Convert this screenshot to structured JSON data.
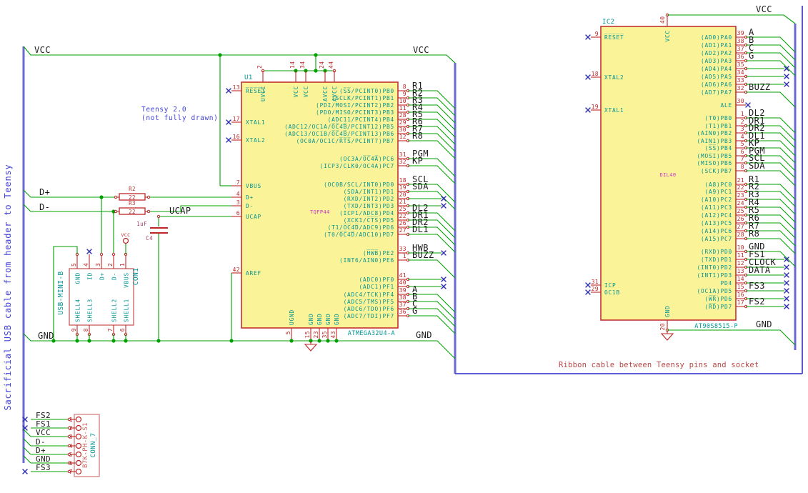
{
  "colors": {
    "wire": "#00a000",
    "bus": "#6a6ad4",
    "frame": "#4646cf",
    "pin": "#bf2626",
    "body_fill": "#fbf397",
    "name_cyan": "#009494",
    "label_black": "#1a1a1a",
    "note_blue": "#4141d9",
    "note_red": "#b94646",
    "magenta": "#c935c9",
    "comp_red": "#b03030",
    "cap_magenta": "#a83d6e",
    "conn_pink": "#d98989",
    "nc_blue": "#2f2fae"
  },
  "notes": {
    "teensy_line1": "Teensy 2.0",
    "teensy_line2": "(not fully drawn)",
    "usb_cable": "Sacrificial USB cable from header to Teensy",
    "ribbon": "Ribbon cable between Teensy pins and socket"
  },
  "power": {
    "vcc_left": "VCC",
    "vcc_mid": "VCC",
    "vcc_right": "VCC",
    "gnd_left": "GND",
    "gnd_mid": "GND",
    "gnd_right": "GND",
    "dplus": "D+",
    "dminus": "D-",
    "ucap": "UCAP",
    "vcc_flag": "VCC"
  },
  "u1": {
    "ref": "U1",
    "value": "ATMEGA32U4-A",
    "footprint": "TQFP44",
    "top_pins": [
      {
        "num": "2",
        "name": "UVCC"
      },
      {
        "num": "14",
        "name": "VCC"
      },
      {
        "num": "34",
        "name": "VCC"
      },
      {
        "num": "24",
        "name": "AVCC"
      },
      {
        "num": "44",
        "name": "AVCC"
      }
    ],
    "bottom_pins": [
      {
        "num": "5",
        "name": "UGND"
      },
      {
        "num": "15",
        "name": "GND"
      },
      {
        "num": "23",
        "name": "GND"
      },
      {
        "num": "35",
        "name": "GND"
      },
      {
        "num": "43",
        "name": "GND"
      }
    ],
    "left_pins": [
      {
        "num": "13",
        "name": "R̅E̅S̅E̅T̅",
        "conn": "nc"
      },
      {
        "num": "17",
        "name": "XTAL1",
        "conn": "nc"
      },
      {
        "num": "16",
        "name": "XTAL2",
        "conn": "nc"
      },
      {
        "num": "7",
        "name": "VBUS",
        "conn": "wired"
      },
      {
        "num": "4",
        "name": "D+",
        "conn": "wired"
      },
      {
        "num": "3",
        "name": "D-",
        "conn": "wired"
      },
      {
        "num": "6",
        "name": "UCAP",
        "conn": "wired"
      },
      {
        "num": "42",
        "name": "AREF",
        "conn": "wired"
      }
    ],
    "right_pins": [
      {
        "num": "8",
        "name": "(S̅S̅/PCINT0)PB0",
        "net": "R1",
        "conn": "bus"
      },
      {
        "num": "9",
        "name": "(SCLK/PCINT1)PB1",
        "net": "R2",
        "conn": "bus"
      },
      {
        "num": "10",
        "name": "(PDI/MOSI/PCINT2)PB2",
        "net": "R3",
        "conn": "bus"
      },
      {
        "num": "11",
        "name": "(PDO/MISO/PCINT3)PB3",
        "net": "R4",
        "conn": "bus"
      },
      {
        "num": "28",
        "name": "(ADC11/PCINT4)PB4",
        "net": "R5",
        "conn": "bus"
      },
      {
        "num": "29",
        "name": "(ADC12/OC1A/O̅C̅4̅B̅/PCINT12)PB5",
        "net": "R6",
        "conn": "bus"
      },
      {
        "num": "30",
        "name": "(ADC13/OC1B/O̅C̅4̅B̅/PCINT13)PB6",
        "net": "R7",
        "conn": "bus"
      },
      {
        "num": "12",
        "name": "(OC0A/OC1C/R̅T̅S̅/PCINT7)PB7",
        "net": "R8",
        "conn": "bus"
      },
      {
        "num": "31",
        "name": "(OC3A/O̅C̅4̅A̅)PC6",
        "net": "PGM",
        "conn": "bus"
      },
      {
        "num": "32",
        "name": "(ICP3/CLK0/OC4A)PC7",
        "net": "KP",
        "conn": "bus"
      },
      {
        "num": "18",
        "name": "(OC0B/SCL/INT0)PD0",
        "net": "SCL",
        "conn": "bus"
      },
      {
        "num": "19",
        "name": "(SDA/INT1)PD1",
        "net": "SDA",
        "conn": "bus"
      },
      {
        "num": "20",
        "name": "(RXD/INT2)PD2",
        "net": "",
        "conn": "nc"
      },
      {
        "num": "21",
        "name": "(TXD/INT3)PD3",
        "net": "",
        "conn": "nc"
      },
      {
        "num": "25",
        "name": "(ICP1/ADC8)PD4",
        "net": "DL2",
        "conn": "bus"
      },
      {
        "num": "22",
        "name": "(XCK1/C̅T̅S̅)PD5",
        "net": "DR1",
        "conn": "bus"
      },
      {
        "num": "26",
        "name": "(T1/O̅C̅4̅D̅/ADC9)PD6",
        "net": "DR2",
        "conn": "bus"
      },
      {
        "num": "27",
        "name": "(T0/O̅C̅4̅D̅/ADC10)PD7",
        "net": "DL1",
        "conn": "bus"
      },
      {
        "num": "33",
        "name": "(H̅W̅B̅)PE2",
        "net": "HWB",
        "conn": "nc"
      },
      {
        "num": "1",
        "name": "(INT6/AIN0)PE6",
        "net": "BUZZ",
        "conn": "bus"
      },
      {
        "num": "41",
        "name": "(ADC0)PF0",
        "net": "",
        "conn": "nc"
      },
      {
        "num": "40",
        "name": "(ADC1)PF1",
        "net": "",
        "conn": "nc"
      },
      {
        "num": "39",
        "name": "(ADC4/TCK)PF4",
        "net": "A",
        "conn": "bus"
      },
      {
        "num": "38",
        "name": "(ADC5/TMS)PF5",
        "net": "B",
        "conn": "bus"
      },
      {
        "num": "37",
        "name": "(ADC6/TDO)PF6",
        "net": "C",
        "conn": "bus"
      },
      {
        "num": "36",
        "name": "(ADC7/TDI)PF7",
        "net": "G",
        "conn": "bus"
      }
    ]
  },
  "r2": {
    "ref": "R2",
    "value": "22"
  },
  "r3": {
    "ref": "R3",
    "value": "22"
  },
  "c4": {
    "ref": "C4",
    "value": "1uF"
  },
  "con1": {
    "ref": "CON1",
    "value": "USB-MINI-B",
    "top_pins": [
      {
        "num": "5",
        "name": "GND"
      },
      {
        "num": "4",
        "name": "ID"
      },
      {
        "num": "3",
        "name": "D+"
      },
      {
        "num": "2",
        "name": "D-"
      },
      {
        "num": "1",
        "name": "VBUS"
      }
    ],
    "shell_pins": [
      {
        "num": "9",
        "name": "SHELL4"
      },
      {
        "num": "8",
        "name": "SHELL3"
      },
      {
        "num": "7",
        "name": "SHELL2"
      },
      {
        "num": "6",
        "name": "SHELL1"
      }
    ]
  },
  "conn7": {
    "ref": "CONN_7",
    "value": "B7K-PH-K-S1",
    "rows": [
      {
        "num": "1",
        "label": "FS2",
        "conn": "nc"
      },
      {
        "num": "2",
        "label": "FS1",
        "conn": "nc"
      },
      {
        "num": "3",
        "label": "VCC",
        "conn": "bus"
      },
      {
        "num": "4",
        "label": "D-",
        "conn": "bus"
      },
      {
        "num": "5",
        "label": "D+",
        "conn": "bus"
      },
      {
        "num": "6",
        "label": "GND",
        "conn": "bus"
      },
      {
        "num": "7",
        "label": "FS3",
        "conn": "nc"
      }
    ]
  },
  "ic2": {
    "ref": "IC2",
    "value": "AT90S8515-P",
    "footprint": "DIL40",
    "top_pin": {
      "num": "40",
      "name": "VCC"
    },
    "bottom_pin": {
      "num": "20",
      "name": "GND"
    },
    "left_pins": [
      {
        "num": "9",
        "name": "R̅E̅S̅E̅T̅",
        "conn": "nc"
      },
      {
        "num": "18",
        "name": "XTAL2",
        "conn": "nc"
      },
      {
        "num": "19",
        "name": "XTAL1",
        "conn": "nc"
      },
      {
        "num": "31",
        "name": "ICP",
        "conn": "nc"
      },
      {
        "num": "29",
        "name": "OC1B",
        "conn": "nc"
      }
    ],
    "right_pins": [
      {
        "num": "39",
        "name": "(AD0)PA0",
        "net": "A",
        "conn": "bus"
      },
      {
        "num": "38",
        "name": "(AD1)PA1",
        "net": "B",
        "conn": "bus"
      },
      {
        "num": "37",
        "name": "(AD2)PA2",
        "net": "C",
        "conn": "bus"
      },
      {
        "num": "36",
        "name": "(AD3)PA3",
        "net": "G",
        "conn": "bus"
      },
      {
        "num": "35",
        "name": "(AD4)PA4",
        "net": "",
        "conn": "nc"
      },
      {
        "num": "34",
        "name": "(AD5)PA5",
        "net": "",
        "conn": "nc"
      },
      {
        "num": "33",
        "name": "(AD6)PA6",
        "net": "",
        "conn": "nc"
      },
      {
        "num": "32",
        "name": "(AD7)PA7",
        "net": "BUZZ",
        "conn": "bus"
      },
      {
        "num": "30",
        "name": "ALE",
        "net": "",
        "conn": "ncshort"
      },
      {
        "num": "1",
        "name": "(T0)PB0",
        "net": "DL2",
        "conn": "bus"
      },
      {
        "num": "2",
        "name": "(T1)PB1",
        "net": "DR1",
        "conn": "bus"
      },
      {
        "num": "3",
        "name": "(AIN0)PB2",
        "net": "DR2",
        "conn": "bus"
      },
      {
        "num": "4",
        "name": "(AIN1)PB3",
        "net": "DL1",
        "conn": "bus"
      },
      {
        "num": "5",
        "name": "(S̅S̅)PB4",
        "net": "KP",
        "conn": "bus"
      },
      {
        "num": "6",
        "name": "(MOSI)PB5",
        "net": "PGM",
        "conn": "bus"
      },
      {
        "num": "7",
        "name": "(MISO)PB6",
        "net": "SCL",
        "conn": "bus"
      },
      {
        "num": "8",
        "name": "(SCK)PB7",
        "net": "SDA",
        "conn": "bus"
      },
      {
        "num": "21",
        "name": "(A8)PC0",
        "net": "R1",
        "conn": "bus"
      },
      {
        "num": "22",
        "name": "(A9)PC1",
        "net": "R2",
        "conn": "bus"
      },
      {
        "num": "23",
        "name": "(A10)PC2",
        "net": "R3",
        "conn": "bus"
      },
      {
        "num": "24",
        "name": "(A11)PC3",
        "net": "R4",
        "conn": "bus"
      },
      {
        "num": "25",
        "name": "(A12)PC4",
        "net": "R5",
        "conn": "bus"
      },
      {
        "num": "26",
        "name": "(A13)PC5",
        "net": "R6",
        "conn": "bus"
      },
      {
        "num": "27",
        "name": "(A14)PC6",
        "net": "R7",
        "conn": "bus"
      },
      {
        "num": "28",
        "name": "(A15)PC7",
        "net": "R8",
        "conn": "bus"
      },
      {
        "num": "10",
        "name": "(RXD)PD0",
        "net": "GND",
        "conn": "bus"
      },
      {
        "num": "11",
        "name": "(TXD)PD1",
        "net": "FS1",
        "conn": "nc"
      },
      {
        "num": "12",
        "name": "(INT0)PD2",
        "net": "CLOCK",
        "conn": "nc"
      },
      {
        "num": "13",
        "name": "(INT1)PD3",
        "net": "DATA",
        "conn": "nc"
      },
      {
        "num": "14",
        "name": "PD4",
        "net": "",
        "conn": "nc"
      },
      {
        "num": "15",
        "name": "(OC1A)PD5",
        "net": "FS3",
        "conn": "nc"
      },
      {
        "num": "16",
        "name": "(W̅R̅)PD6",
        "net": "",
        "conn": "nc"
      },
      {
        "num": "17",
        "name": "(R̅D̅)PD7",
        "net": "FS2",
        "conn": "nc"
      }
    ]
  }
}
